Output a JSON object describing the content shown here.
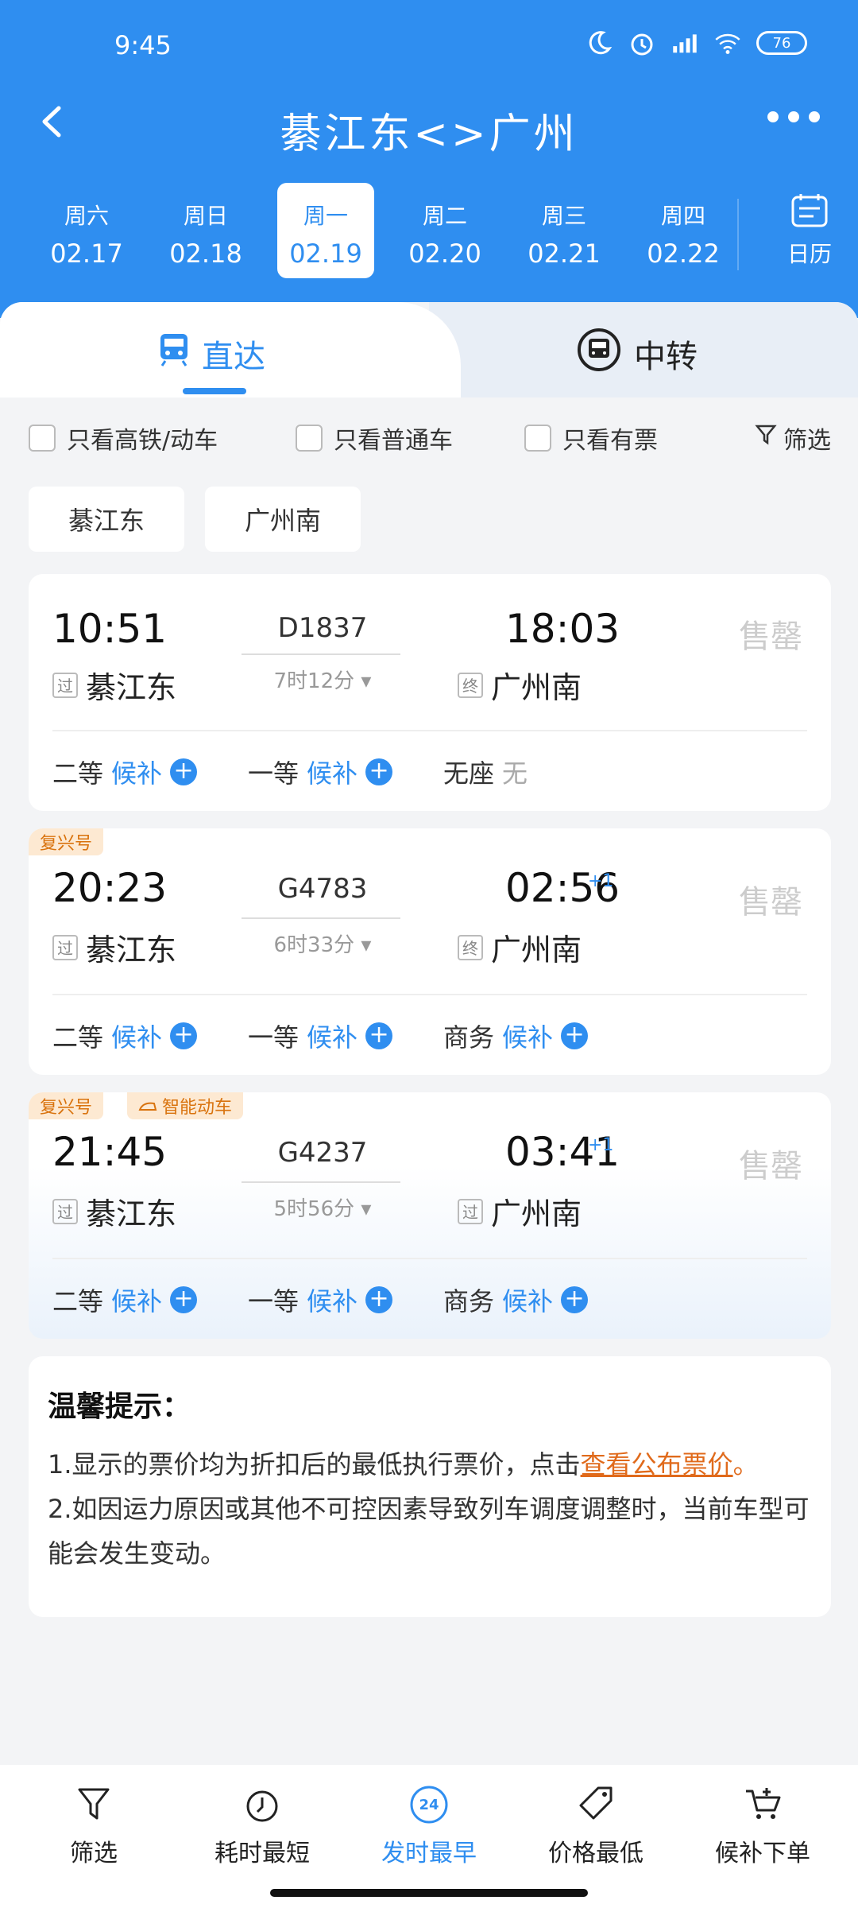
{
  "status": {
    "time": "9:45",
    "battery": "76"
  },
  "header": {
    "title": "綦江东<>广州"
  },
  "dates": [
    {
      "dow": "周六",
      "date": "02.17"
    },
    {
      "dow": "周日",
      "date": "02.18"
    },
    {
      "dow": "周一",
      "date": "02.19",
      "active": true
    },
    {
      "dow": "周二",
      "date": "02.20"
    },
    {
      "dow": "周三",
      "date": "02.21"
    },
    {
      "dow": "周四",
      "date": "02.22"
    }
  ],
  "calendar_label": "日历",
  "tabs": {
    "direct": "直达",
    "transfer": "中转"
  },
  "filters": {
    "high_speed": "只看高铁/动车",
    "normal": "只看普通车",
    "available": "只看有票",
    "filter": "筛选"
  },
  "stations": {
    "from": "綦江东",
    "to": "广州南"
  },
  "trains": [
    {
      "dep_time": "10:51",
      "arr_time": "18:03",
      "arr_plus": "",
      "train_no": "D1837",
      "duration": "7时12分",
      "from_tag": "过",
      "from": "綦江东",
      "to_tag": "终",
      "to": "广州南",
      "status": "售罄",
      "seats": [
        {
          "class": "二等",
          "state": "候补"
        },
        {
          "class": "一等",
          "state": "候补"
        },
        {
          "class": "无座",
          "state": "无"
        }
      ]
    },
    {
      "badge": "复兴号",
      "dep_time": "20:23",
      "arr_time": "02:56",
      "arr_plus": "+1",
      "train_no": "G4783",
      "duration": "6时33分",
      "from_tag": "过",
      "from": "綦江东",
      "to_tag": "终",
      "to": "广州南",
      "status": "售罄",
      "seats": [
        {
          "class": "二等",
          "state": "候补"
        },
        {
          "class": "一等",
          "state": "候补"
        },
        {
          "class": "商务",
          "state": "候补"
        }
      ]
    },
    {
      "badge": "复兴号",
      "badge2": "智能动车",
      "dep_time": "21:45",
      "arr_time": "03:41",
      "arr_plus": "+1",
      "train_no": "G4237",
      "duration": "5时56分",
      "from_tag": "过",
      "from": "綦江东",
      "to_tag": "过",
      "to": "广州南",
      "status": "售罄",
      "seats": [
        {
          "class": "二等",
          "state": "候补"
        },
        {
          "class": "一等",
          "state": "候补"
        },
        {
          "class": "商务",
          "state": "候补"
        }
      ]
    }
  ],
  "tips": {
    "title": "温馨提示：",
    "line1_pre": "1.显示的票价均为折扣后的最低执行票价，点击",
    "line1_link": "查看公布票价",
    "line1_post": "。",
    "line2": "2.如因运力原因或其他不可控因素导致列车调度调整时，当前车型可能会发生变动。"
  },
  "bottom_bar": {
    "filter": "筛选",
    "shortest": "耗时最短",
    "earliest": "发时最早",
    "earliest_icon_text": "24",
    "cheapest": "价格最低",
    "waitlist": "候补下单"
  },
  "colors": {
    "primary": "#2f8ef0",
    "orange": "#e06a1b",
    "badge_bg": "#fde9d2"
  }
}
